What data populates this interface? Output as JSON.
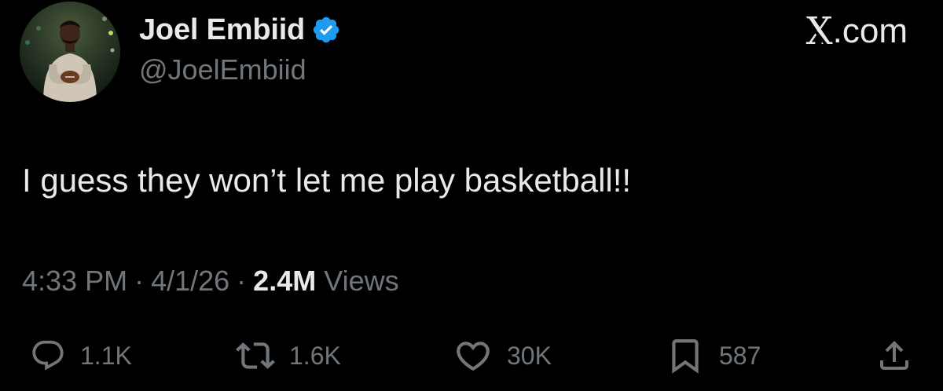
{
  "author": {
    "display_name": "Joel Embiid",
    "handle": "@JoelEmbiid",
    "verified": true,
    "verified_color": "#1d9bf0"
  },
  "brand": {
    "x_glyph": "X",
    "suffix": ".com"
  },
  "tweet": {
    "text": "I guess they won’t let me play basketball!!"
  },
  "meta": {
    "time": "4:33 PM",
    "separator": "·",
    "date": "4/1/26",
    "views_count": "2.4M",
    "views_label": "Views"
  },
  "actions": {
    "replies": "1.1K",
    "reposts": "1.6K",
    "likes": "30K",
    "bookmarks": "587"
  },
  "icons": {
    "reply": "reply-icon",
    "repost": "repost-icon",
    "like": "heart-icon",
    "bookmark": "bookmark-icon",
    "share": "share-icon",
    "verified": "verified-badge-icon"
  },
  "colors": {
    "background": "#000000",
    "primary_text": "#e7e9ea",
    "secondary_text": "#71767b"
  }
}
